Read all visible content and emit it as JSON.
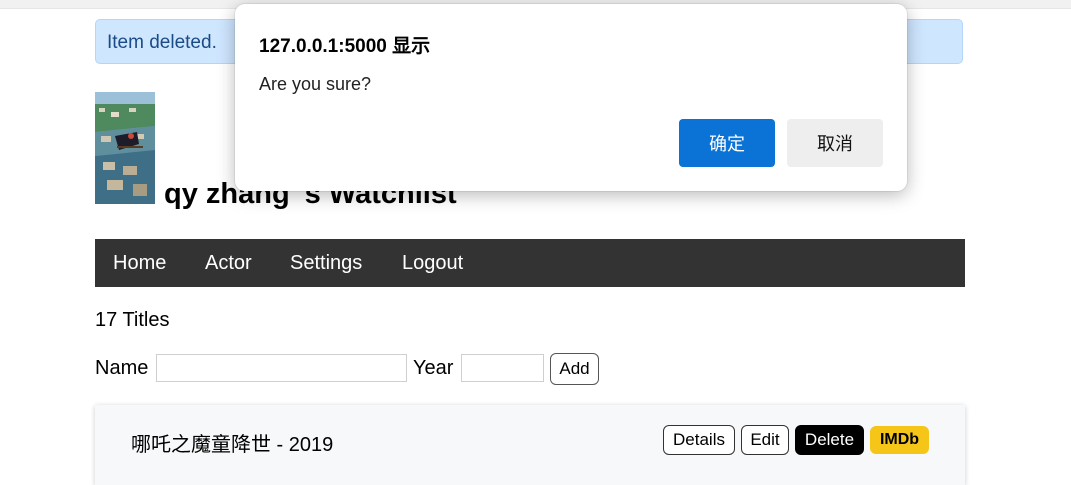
{
  "flash": {
    "message": "Item deleted."
  },
  "header": {
    "title": "qy zhang 's Watchlist",
    "avatar_icon": "avatar-image"
  },
  "nav": {
    "items": [
      {
        "label": "Home"
      },
      {
        "label": "Actor"
      },
      {
        "label": "Settings"
      },
      {
        "label": "Logout"
      }
    ],
    "background": "#333333"
  },
  "main": {
    "count_text": "17 Titles",
    "form": {
      "name_label": "Name",
      "name_value": "",
      "year_label": "Year",
      "year_value": "",
      "add_label": "Add"
    },
    "items": [
      {
        "title": "哪吒之魔童降世 - 2019",
        "actions": {
          "details": "Details",
          "edit": "Edit",
          "delete": "Delete",
          "imdb": "IMDb"
        }
      }
    ]
  },
  "dialog": {
    "title": "127.0.0.1:5000 显示",
    "message": "Are you sure?",
    "ok_label": "确定",
    "cancel_label": "取消",
    "ok_color": "#0b72d6"
  },
  "colors": {
    "flash_bg": "#cfe6ff",
    "flash_text": "#1b4b86",
    "imdb": "#f5c518"
  }
}
